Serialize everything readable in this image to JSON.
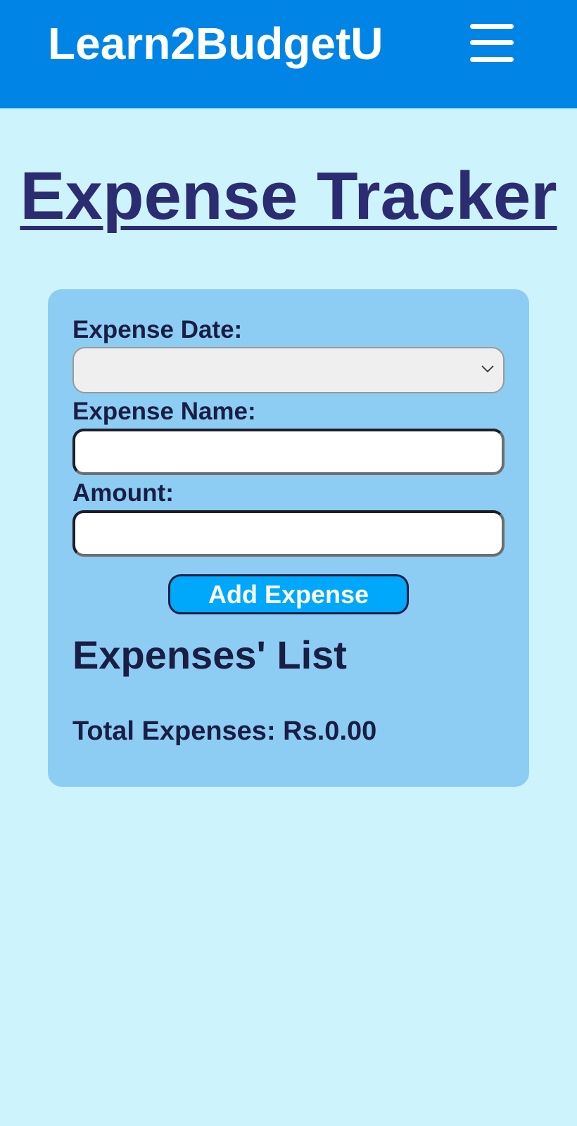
{
  "header": {
    "brand": "Learn2BudgetU",
    "menu_icon": "hamburger-menu-icon"
  },
  "page": {
    "title": "Expense Tracker"
  },
  "form": {
    "date_label": "Expense Date:",
    "date_value": "",
    "name_label": "Expense Name:",
    "name_value": "",
    "amount_label": "Amount:",
    "amount_value": "",
    "submit_label": "Add Expense"
  },
  "list": {
    "heading": "Expenses' List",
    "total_label": "Total Expenses: ",
    "total_value": "Rs.0.00"
  },
  "colors": {
    "header_bg": "#0084e6",
    "page_bg": "#cdf3fd",
    "card_bg": "#8dcdf4",
    "title_text": "#2c2c72",
    "button_bg": "#00a8fb"
  }
}
